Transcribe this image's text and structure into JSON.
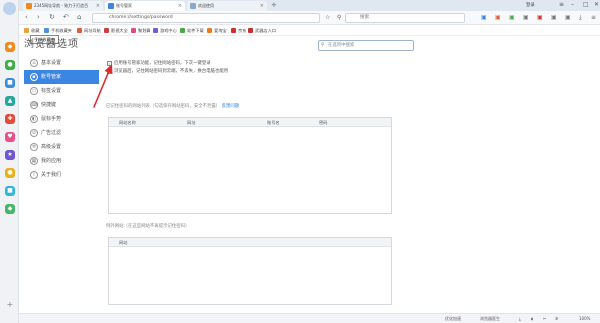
{
  "tabs": [
    {
      "label": "2345网址导航 - 致力于打造百",
      "active": false
    },
    {
      "label": "账号管家",
      "active": true
    },
    {
      "label": "欢迎使用",
      "active": false
    }
  ],
  "window": {
    "user": "登录",
    "controls": [
      "菜单",
      "最小化",
      "最大化",
      "关闭"
    ]
  },
  "address": {
    "url": "chrome://settings/password",
    "search_placeholder": "搜索"
  },
  "bookmarks": [
    {
      "label": "收藏",
      "color": "#e8a33c"
    },
    {
      "label": "手机收藏夹",
      "color": "#4d8fdc"
    },
    {
      "label": "网址导航",
      "color": "#e05d3b"
    },
    {
      "label": "影视大全",
      "color": "#cf3e3e"
    },
    {
      "label": "聚划算",
      "color": "#e04a86"
    },
    {
      "label": "游戏中心",
      "color": "#6a5fd0"
    },
    {
      "label": "软件下载",
      "color": "#4aa74a"
    },
    {
      "label": "爱淘宝",
      "color": "#f07a1a"
    },
    {
      "label": "京东",
      "color": "#d32f2f"
    },
    {
      "label": "武器店入口",
      "color": "#c8302c"
    }
  ],
  "tooltip": "手机收藏夹",
  "page": {
    "title": "浏览器选项",
    "settings_search_placeholder": "在选项中搜索"
  },
  "nav": [
    {
      "label": "基本设置",
      "icon": "home-icon"
    },
    {
      "label": "账号管家",
      "icon": "lock-icon",
      "active": true
    },
    {
      "label": "标签设置",
      "icon": "tab-icon"
    },
    {
      "label": "快捷键",
      "icon": "keyboard-icon"
    },
    {
      "label": "鼠标手势",
      "icon": "mouse-icon"
    },
    {
      "label": "广告过滤",
      "icon": "filter-icon"
    },
    {
      "label": "高级设置",
      "icon": "settings-icon"
    },
    {
      "label": "我的应用",
      "icon": "apps-icon"
    },
    {
      "label": "关于我们",
      "icon": "info-icon"
    }
  ],
  "options": {
    "opt1": "启用账号管家功能，记住网站密码，下次一键登录",
    "opt2": "浏览器后，记住网站密码到云端，不丢失，换台电脑也能用"
  },
  "saved": {
    "heading": "已记住密码的网站列表（勾选保存网站密码，安全不泄露）",
    "link": "反馈问题",
    "columns": [
      "网站名称",
      "网址",
      "账号名",
      "密码"
    ]
  },
  "never": {
    "heading": "例外网站（在这些网站不再提示记住密码）",
    "columns": [
      "网站"
    ]
  },
  "status": {
    "items": [
      "优化加速",
      "浏览器医生",
      "100%"
    ]
  },
  "colors": {
    "accent": "#3b86e3",
    "arrow": "#d62d2d"
  }
}
